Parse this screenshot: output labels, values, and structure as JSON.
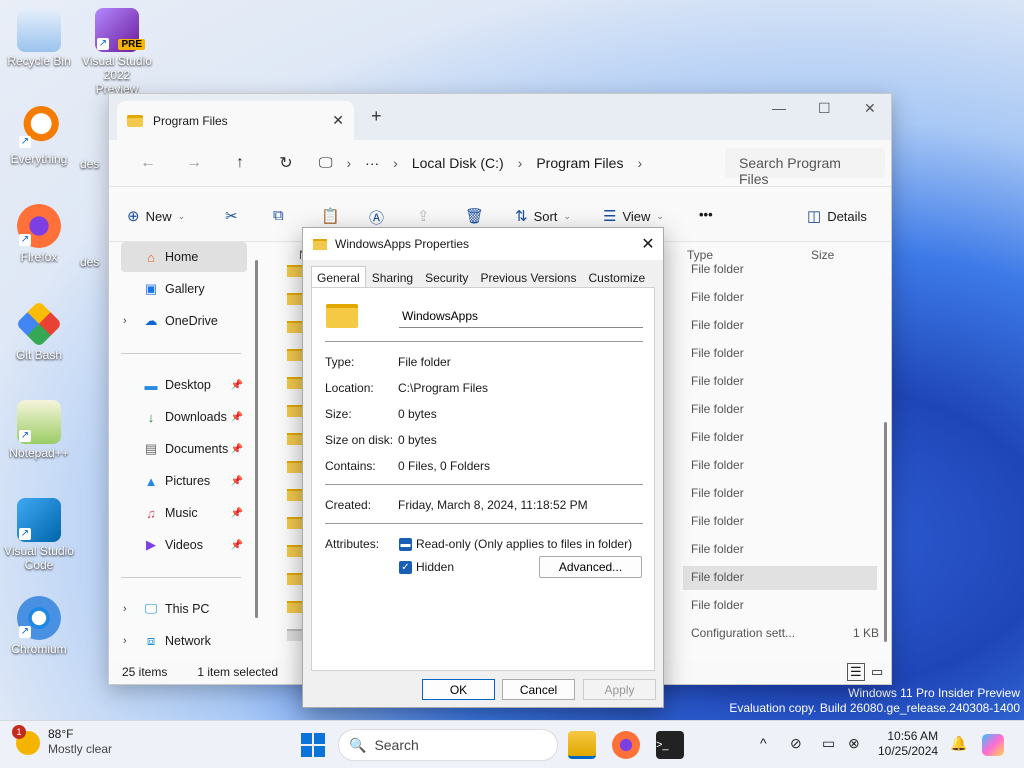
{
  "desktop": {
    "icons": [
      {
        "label": "Recycle Bin",
        "icon": "recycle-bin-icon"
      },
      {
        "label": "Visual Studio 2022 Preview",
        "icon": "visual-studio-icon",
        "badge": "PRE"
      },
      {
        "label": "Everything",
        "icon": "everything-search-icon"
      },
      {
        "label": "Firefox",
        "icon": "firefox-icon"
      },
      {
        "label": "Git Bash",
        "icon": "git-bash-icon"
      },
      {
        "label": "Notepad++",
        "icon": "notepad-plus-plus-icon"
      },
      {
        "label": "Visual Studio Code",
        "icon": "vscode-icon"
      },
      {
        "label": "Chromium",
        "icon": "chromium-icon"
      }
    ],
    "partial_labels": [
      "des",
      "des"
    ],
    "watermark": [
      "Windows 11 Pro Insider Preview",
      "Evaluation copy. Build 26080.ge_release.240308-1400"
    ]
  },
  "explorer": {
    "tab_title": "Program Files",
    "new_tab": "+",
    "breadcrumb": [
      "Local Disk (C:)",
      "Program Files"
    ],
    "more_crumbs": "···",
    "search_placeholder": "Search Program Files",
    "toolbar": {
      "new": "New",
      "sort": "Sort",
      "view": "View",
      "more": "•••",
      "details": "Details"
    },
    "nav": {
      "home": "Home",
      "gallery": "Gallery",
      "onedrive": "OneDrive",
      "desktop": "Desktop",
      "downloads": "Downloads",
      "documents": "Documents",
      "pictures": "Pictures",
      "music": "Music",
      "videos": "Videos",
      "thispc": "This PC",
      "network": "Network"
    },
    "columns": {
      "name_partial": "N",
      "type": "Type",
      "size": "Size"
    },
    "rows": [
      {
        "type": "File folder"
      },
      {
        "type": "File folder"
      },
      {
        "type": "File folder"
      },
      {
        "type": "File folder"
      },
      {
        "type": "File folder"
      },
      {
        "type": "File folder"
      },
      {
        "type": "File folder"
      },
      {
        "type": "File folder"
      },
      {
        "type": "File folder"
      },
      {
        "type": "File folder"
      },
      {
        "type": "File folder"
      },
      {
        "type": "File folder"
      },
      {
        "type": "File folder"
      },
      {
        "type": "Configuration sett...",
        "size": "1 KB"
      }
    ],
    "status": {
      "items": "25 items",
      "selected": "1 item selected"
    }
  },
  "dialog": {
    "title": "WindowsApps Properties",
    "tabs": [
      "General",
      "Sharing",
      "Security",
      "Previous Versions",
      "Customize"
    ],
    "name": "WindowsApps",
    "props": {
      "type_label": "Type:",
      "type": "File folder",
      "location_label": "Location:",
      "location": "C:\\Program Files",
      "size_label": "Size:",
      "size": "0 bytes",
      "size_on_disk_label": "Size on disk:",
      "size_on_disk": "0 bytes",
      "contains_label": "Contains:",
      "contains": "0 Files, 0 Folders",
      "created_label": "Created:",
      "created": "Friday, March 8, 2024, 11:18:52 PM",
      "attributes_label": "Attributes:"
    },
    "attributes": {
      "readonly": "Read-only (Only applies to files in folder)",
      "hidden": "Hidden"
    },
    "advanced": "Advanced...",
    "ok": "OK",
    "cancel": "Cancel",
    "apply": "Apply"
  },
  "taskbar": {
    "weather_badge": "1",
    "temperature": "88°F",
    "condition": "Mostly clear",
    "search": "Search",
    "time": "10:56 AM",
    "date": "10/25/2024"
  }
}
